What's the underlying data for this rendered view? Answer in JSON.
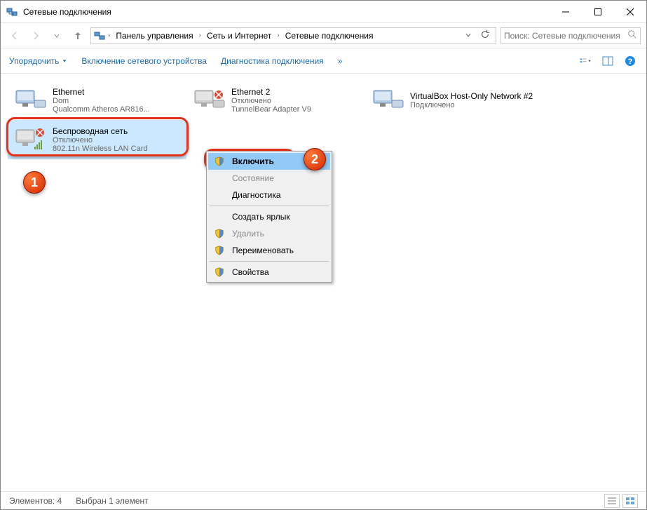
{
  "window": {
    "title": "Сетевые подключения"
  },
  "breadcrumbs": {
    "items": [
      "Панель управления",
      "Сеть и Интернет",
      "Сетевые подключения"
    ]
  },
  "search": {
    "placeholder": "Поиск: Сетевые подключения"
  },
  "toolbar": {
    "organize": "Упорядочить",
    "enable_device": "Включение сетевого устройства",
    "diagnose": "Диагностика подключения",
    "more": "»"
  },
  "connections": [
    {
      "name": "Ethernet",
      "status": "Dom",
      "device": "Qualcomm Atheros AR816..."
    },
    {
      "name": "Ethernet 2",
      "status": "Отключено",
      "device": "TunnelBear Adapter V9"
    },
    {
      "name": "VirtualBox Host-Only Network #2",
      "status": "Подключено",
      "device": ""
    },
    {
      "name": "Беспроводная сеть",
      "status": "Отключено",
      "device": "802.11n Wireless LAN Card"
    }
  ],
  "context_menu": {
    "enable": "Включить",
    "status": "Состояние",
    "diagnose": "Диагностика",
    "create_shortcut": "Создать ярлык",
    "delete": "Удалить",
    "rename": "Переименовать",
    "properties": "Свойства"
  },
  "statusbar": {
    "count_label": "Элементов: 4",
    "selected_label": "Выбран 1 элемент"
  },
  "annotations": {
    "badge1": "1",
    "badge2": "2"
  }
}
